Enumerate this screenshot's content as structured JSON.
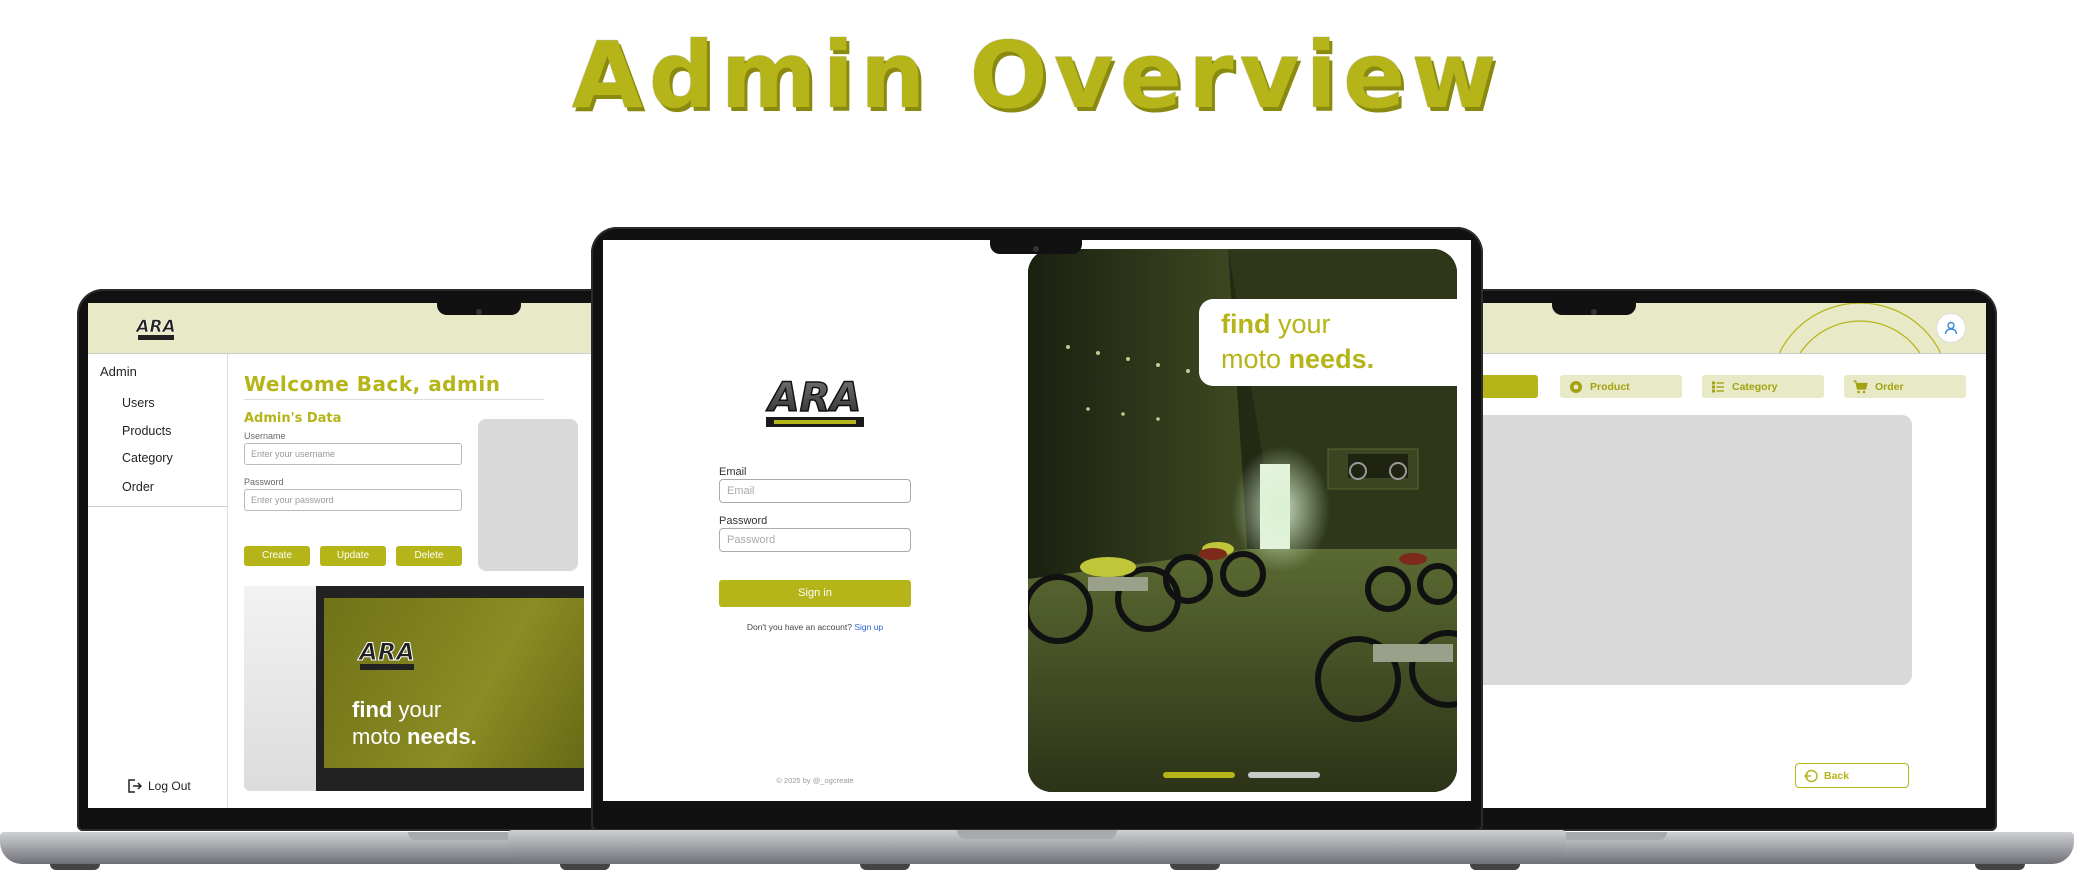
{
  "title": "Admin Overview",
  "colors": {
    "accent": "#b5b418",
    "accent_light": "#e8e9c6",
    "panel_gray": "#d9d9d9"
  },
  "admin_panel": {
    "sidebar": {
      "heading": "Admin",
      "items": [
        {
          "label": "Users"
        },
        {
          "label": "Products"
        },
        {
          "label": "Category"
        },
        {
          "label": "Order"
        }
      ],
      "logout_label": "Log Out"
    },
    "welcome": "Welcome Back, admin",
    "section_title": "Admin's Data",
    "username_label": "Username",
    "username_placeholder": "Enter your username",
    "password_label": "Password",
    "password_placeholder": "Enter your password",
    "buttons": {
      "create": "Create",
      "update": "Update",
      "delete": "Delete"
    },
    "promo_text_find": "find",
    "promo_text_your": "your",
    "promo_text_moto": "moto",
    "promo_text_needs": "needs."
  },
  "login_page": {
    "email_label": "Email",
    "email_placeholder": "Email",
    "password_label": "Password",
    "password_placeholder": "Password",
    "signin_label": "Sign in",
    "signup_prompt": "Don't you have an account?",
    "signup_link": "Sign up",
    "copyright": "© 2025 by @_ogcreate",
    "hero_find": "find",
    "hero_your": "your",
    "hero_moto": "moto",
    "hero_needs": "needs.",
    "carousel": {
      "active_index": 0,
      "count": 2
    }
  },
  "dashboard": {
    "nav": [
      {
        "label": "Product",
        "icon": "box-icon"
      },
      {
        "label": "Category",
        "icon": "list-icon"
      },
      {
        "label": "Order",
        "icon": "cart-icon"
      }
    ],
    "back_label": "Back"
  }
}
